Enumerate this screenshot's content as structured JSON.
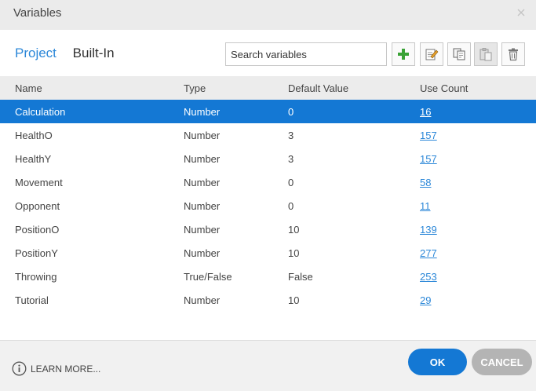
{
  "window": {
    "title": "Variables"
  },
  "tabs": [
    {
      "label": "Project",
      "active": true
    },
    {
      "label": "Built-In",
      "active": false
    }
  ],
  "search": {
    "placeholder": "Search variables",
    "value": ""
  },
  "toolbar": [
    {
      "icon": "add-icon",
      "enabled": true
    },
    {
      "icon": "edit-icon",
      "enabled": true
    },
    {
      "icon": "copy-icon",
      "enabled": true
    },
    {
      "icon": "paste-icon",
      "enabled": false
    },
    {
      "icon": "delete-icon",
      "enabled": true
    }
  ],
  "table": {
    "headers": {
      "name": "Name",
      "type": "Type",
      "default": "Default Value",
      "use": "Use Count"
    },
    "rows": [
      {
        "name": "Calculation",
        "type": "Number",
        "default": "0",
        "use": "16",
        "selected": true
      },
      {
        "name": "HealthO",
        "type": "Number",
        "default": "3",
        "use": "157"
      },
      {
        "name": "HealthY",
        "type": "Number",
        "default": "3",
        "use": "157"
      },
      {
        "name": "Movement",
        "type": "Number",
        "default": "0",
        "use": "58"
      },
      {
        "name": "Opponent",
        "type": "Number",
        "default": "0",
        "use": "11"
      },
      {
        "name": "PositionO",
        "type": "Number",
        "default": "10",
        "use": "139"
      },
      {
        "name": "PositionY",
        "type": "Number",
        "default": "10",
        "use": "277"
      },
      {
        "name": "Throwing",
        "type": "True/False",
        "default": "False",
        "use": "253"
      },
      {
        "name": "Tutorial",
        "type": "Number",
        "default": "10",
        "use": "29"
      }
    ]
  },
  "footer": {
    "learn_more": "LEARN MORE...",
    "ok": "OK",
    "cancel": "CANCEL"
  },
  "colors": {
    "accent": "#1478d4",
    "link": "#2b87d8",
    "selected_row": "#1478d4",
    "cancel": "#b4b4b4"
  }
}
